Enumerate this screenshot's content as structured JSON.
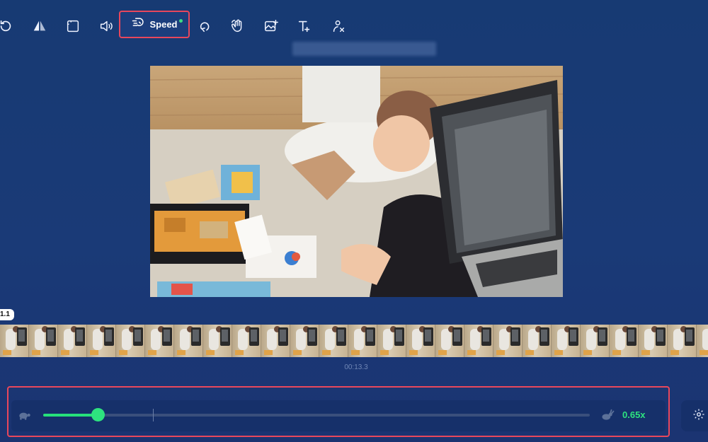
{
  "toolbar": {
    "tools": [
      {
        "name": "rotate-icon"
      },
      {
        "name": "flip-icon"
      },
      {
        "name": "crop-icon"
      },
      {
        "name": "volume-icon"
      },
      {
        "name": "speed",
        "label": "Speed"
      },
      {
        "name": "loop-icon"
      },
      {
        "name": "wave-hand-icon"
      },
      {
        "name": "add-image-icon"
      },
      {
        "name": "text-icon"
      },
      {
        "name": "remove-person-icon"
      }
    ],
    "speed_label": "Speed"
  },
  "timeline": {
    "time_badge": "1.1",
    "timestamp": "00:13.3"
  },
  "speed_control": {
    "value": 0.65,
    "value_label": "0.65x",
    "colors": {
      "accent": "#2ee37f",
      "highlight_border": "#e8475c"
    }
  }
}
